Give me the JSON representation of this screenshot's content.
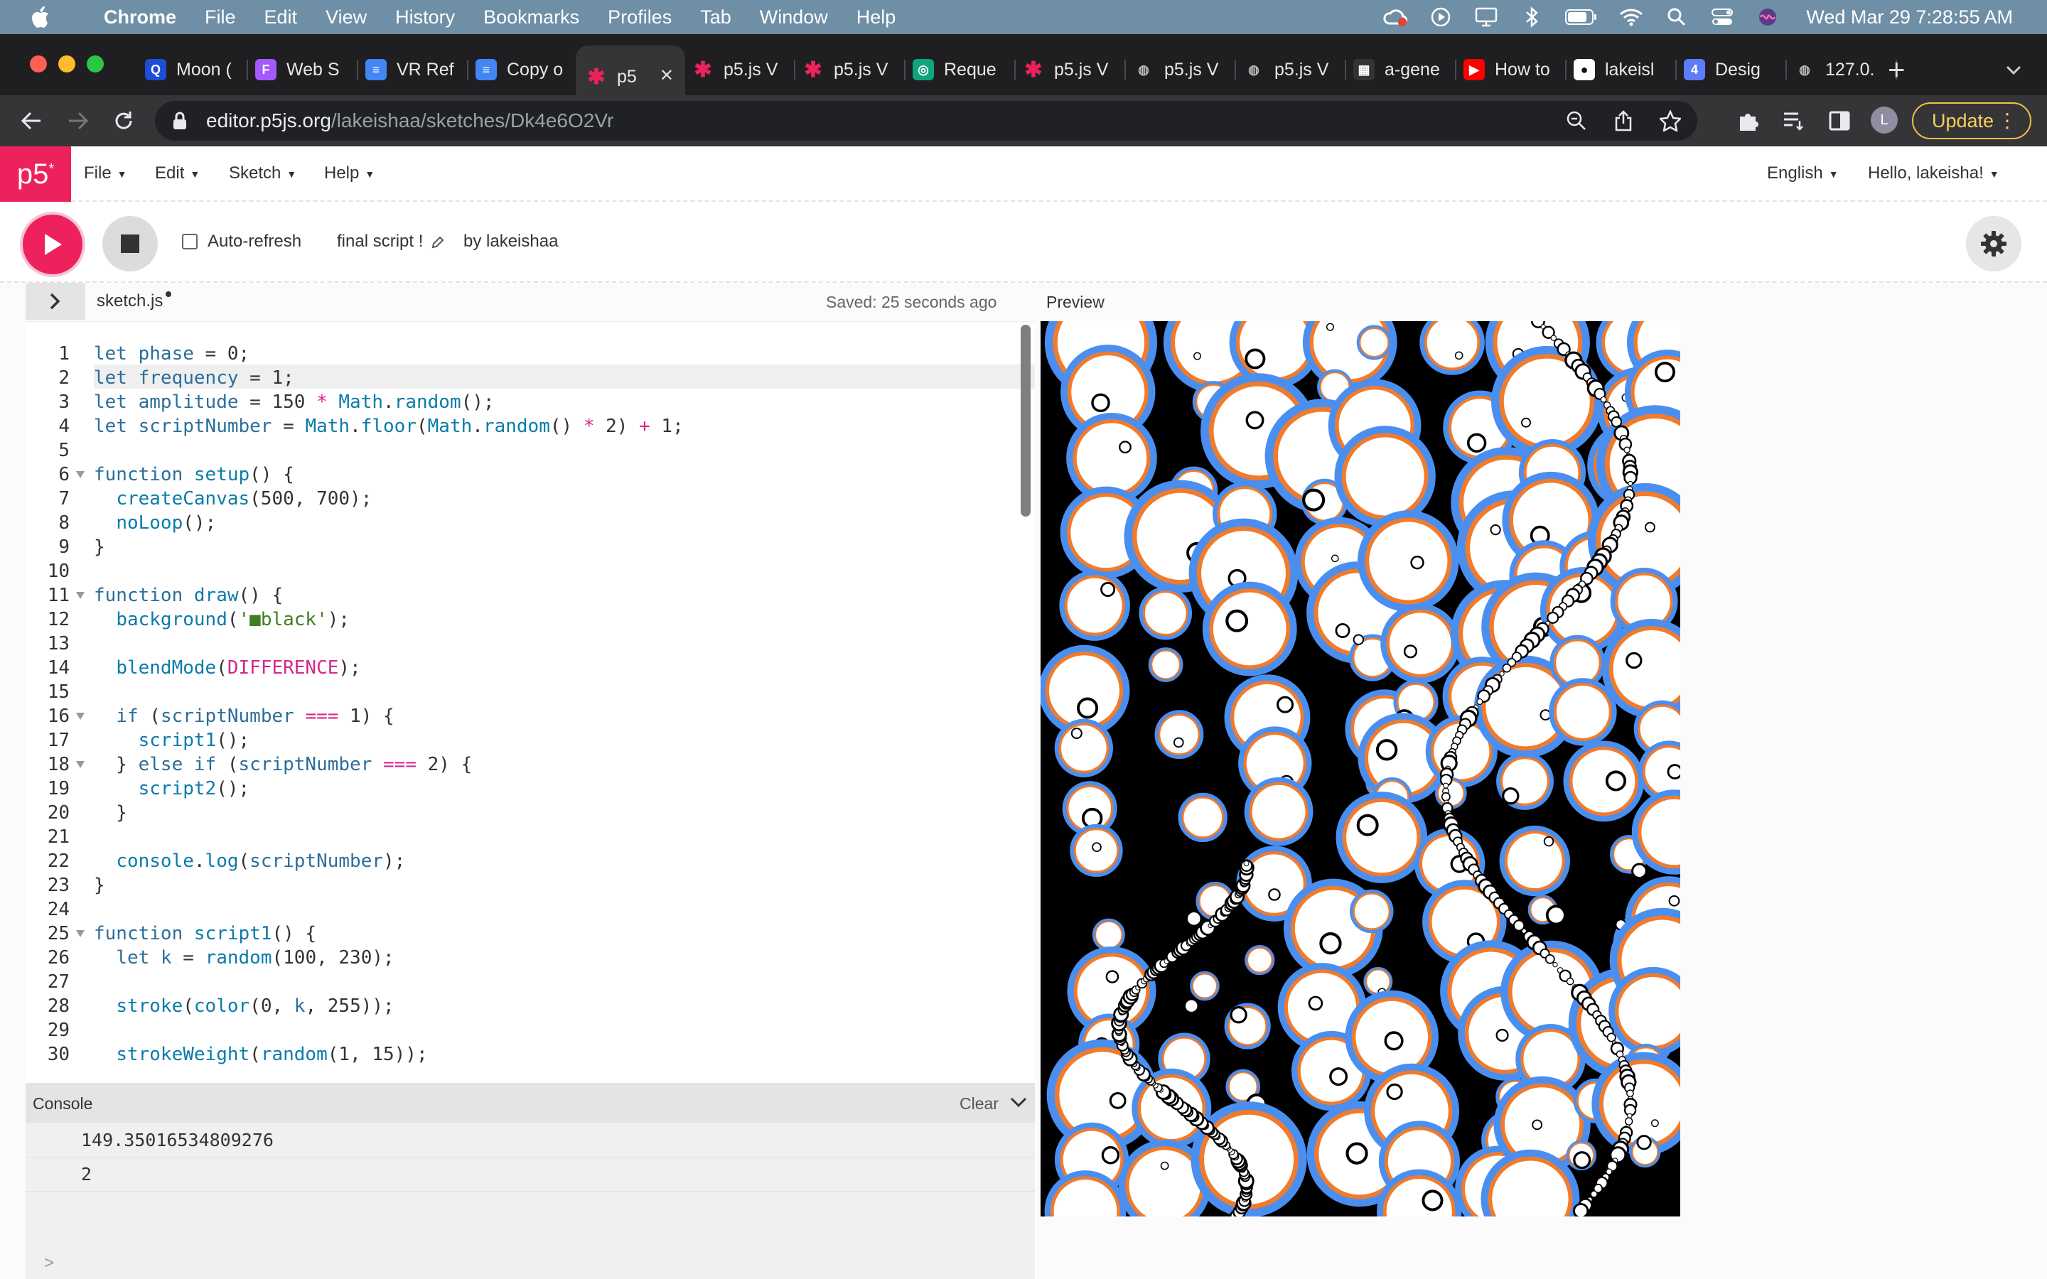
{
  "mac_menubar": {
    "app": "Chrome",
    "items": [
      "File",
      "Edit",
      "View",
      "History",
      "Bookmarks",
      "Profiles",
      "Tab",
      "Window",
      "Help"
    ],
    "clock": "Wed Mar 29  7:28:55 AM",
    "status_icons": [
      "creative-cloud-icon",
      "play-circle-icon",
      "display-icon",
      "bluetooth-icon",
      "battery-icon",
      "wifi-icon",
      "spotlight-search-icon",
      "control-center-icon",
      "siri-icon"
    ]
  },
  "tabs": [
    {
      "title": "Moon (",
      "icon": "q"
    },
    {
      "title": "Web S",
      "icon": "figma"
    },
    {
      "title": "VR Ref",
      "icon": "doc"
    },
    {
      "title": "Copy o",
      "icon": "doc"
    },
    {
      "title": "p5",
      "icon": "p5",
      "active": true
    },
    {
      "title": "p5.js V",
      "icon": "p5"
    },
    {
      "title": "p5.js V",
      "icon": "p5"
    },
    {
      "title": "Reque",
      "icon": "openai"
    },
    {
      "title": "p5.js V",
      "icon": "p5"
    },
    {
      "title": "p5.js V",
      "icon": "globe"
    },
    {
      "title": "p5.js V",
      "icon": "globe"
    },
    {
      "title": "a-gene",
      "icon": "grid"
    },
    {
      "title": "How to",
      "icon": "youtube"
    },
    {
      "title": "lakeisl",
      "icon": "github"
    },
    {
      "title": "Desig",
      "icon": "four"
    },
    {
      "title": "127.0.",
      "icon": "globe"
    }
  ],
  "address": {
    "host": "editor.p5js.org",
    "path": "/lakeishaa/sketches/Dk4e6O2Vr"
  },
  "update_label": "Update",
  "avatar_letter": "L",
  "p5": {
    "logo": "p5",
    "menus": [
      "File",
      "Edit",
      "Sketch",
      "Help"
    ],
    "language": "English",
    "greeting": "Hello, lakeisha!",
    "auto_refresh": "Auto-refresh",
    "sketch_name": "final script !",
    "author": "by lakeishaa",
    "file_tab": "sketch.js",
    "saved_status": "Saved: 25 seconds ago",
    "preview_label": "Preview",
    "console_title": "Console",
    "console_clear": "Clear",
    "console_output": [
      "149.35016534809276",
      "2"
    ],
    "prompt": ">"
  },
  "code": [
    [
      [
        "v",
        "let "
      ],
      [
        "v",
        "phase"
      ],
      [
        "n",
        " = 0;"
      ]
    ],
    [
      [
        "v",
        "let "
      ],
      [
        "v",
        "frequency"
      ],
      [
        "n",
        " = 1;"
      ]
    ],
    [
      [
        "v",
        "let "
      ],
      [
        "v",
        "amplitude"
      ],
      [
        "n",
        " = 150 "
      ],
      [
        "c",
        "*"
      ],
      [
        "n",
        " "
      ],
      [
        "fn",
        "Math"
      ],
      [
        "n",
        "."
      ],
      [
        "fn",
        "random"
      ],
      [
        "n",
        "();"
      ]
    ],
    [
      [
        "v",
        "let "
      ],
      [
        "v",
        "scriptNumber"
      ],
      [
        "n",
        " = "
      ],
      [
        "fn",
        "Math"
      ],
      [
        "n",
        "."
      ],
      [
        "fn",
        "floor"
      ],
      [
        "n",
        "("
      ],
      [
        "fn",
        "Math"
      ],
      [
        "n",
        "."
      ],
      [
        "fn",
        "random"
      ],
      [
        "n",
        "() "
      ],
      [
        "c",
        "*"
      ],
      [
        "n",
        " 2) "
      ],
      [
        "c",
        "+"
      ],
      [
        "n",
        " 1;"
      ]
    ],
    [],
    [
      [
        "v",
        "function "
      ],
      [
        "fn",
        "setup"
      ],
      [
        "n",
        "() {"
      ]
    ],
    [
      [
        "n",
        "  "
      ],
      [
        "fn",
        "createCanvas"
      ],
      [
        "n",
        "(500, 700);"
      ]
    ],
    [
      [
        "n",
        "  "
      ],
      [
        "fn",
        "noLoop"
      ],
      [
        "n",
        "();"
      ]
    ],
    [
      [
        "n",
        "}"
      ]
    ],
    [],
    [
      [
        "v",
        "function "
      ],
      [
        "fn",
        "draw"
      ],
      [
        "n",
        "() {"
      ]
    ],
    [
      [
        "n",
        "  "
      ],
      [
        "fn",
        "background"
      ],
      [
        "n",
        "("
      ],
      [
        "s",
        "'■black'"
      ],
      [
        "n",
        ");"
      ]
    ],
    [],
    [
      [
        "n",
        "  "
      ],
      [
        "fn",
        "blendMode"
      ],
      [
        "n",
        "("
      ],
      [
        "c",
        "DIFFERENCE"
      ],
      [
        "n",
        ");"
      ]
    ],
    [],
    [
      [
        "n",
        "  "
      ],
      [
        "v",
        "if"
      ],
      [
        "n",
        " ("
      ],
      [
        "v",
        "scriptNumber"
      ],
      [
        "n",
        " "
      ],
      [
        "c",
        "==="
      ],
      [
        "n",
        " 1) {"
      ]
    ],
    [
      [
        "n",
        "    "
      ],
      [
        "fn",
        "script1"
      ],
      [
        "n",
        "();"
      ]
    ],
    [
      [
        "n",
        "  } "
      ],
      [
        "v",
        "else if"
      ],
      [
        "n",
        " ("
      ],
      [
        "v",
        "scriptNumber"
      ],
      [
        "n",
        " "
      ],
      [
        "c",
        "==="
      ],
      [
        "n",
        " 2) {"
      ]
    ],
    [
      [
        "n",
        "    "
      ],
      [
        "fn",
        "script2"
      ],
      [
        "n",
        "();"
      ]
    ],
    [
      [
        "n",
        "  }"
      ]
    ],
    [],
    [
      [
        "n",
        "  "
      ],
      [
        "fn",
        "console"
      ],
      [
        "n",
        "."
      ],
      [
        "fn",
        "log"
      ],
      [
        "n",
        "("
      ],
      [
        "v",
        "scriptNumber"
      ],
      [
        "n",
        ");"
      ]
    ],
    [
      [
        "n",
        "}"
      ]
    ],
    [],
    [
      [
        "v",
        "function "
      ],
      [
        "fn",
        "script1"
      ],
      [
        "n",
        "() {"
      ]
    ],
    [
      [
        "n",
        "  "
      ],
      [
        "v",
        "let "
      ],
      [
        "v",
        "k"
      ],
      [
        "n",
        " = "
      ],
      [
        "fn",
        "random"
      ],
      [
        "n",
        "(100, 230);"
      ]
    ],
    [],
    [
      [
        "n",
        "  "
      ],
      [
        "fn",
        "stroke"
      ],
      [
        "n",
        "("
      ],
      [
        "fn",
        "color"
      ],
      [
        "n",
        "(0, "
      ],
      [
        "v",
        "k"
      ],
      [
        "n",
        ", 255));"
      ]
    ],
    [],
    [
      [
        "n",
        "  "
      ],
      [
        "fn",
        "strokeWeight"
      ],
      [
        "n",
        "("
      ],
      [
        "fn",
        "random"
      ],
      [
        "n",
        "(1, 15));"
      ]
    ]
  ],
  "fold_lines": [
    6,
    11,
    16,
    18,
    25
  ],
  "highlight_line": 2,
  "colors": {
    "menubar": "#6f8fa6",
    "p5_pink": "#ed225d",
    "tab_bg": "#1f1f22",
    "toolbar_bg": "#353538",
    "update_gold": "#f2c246"
  }
}
